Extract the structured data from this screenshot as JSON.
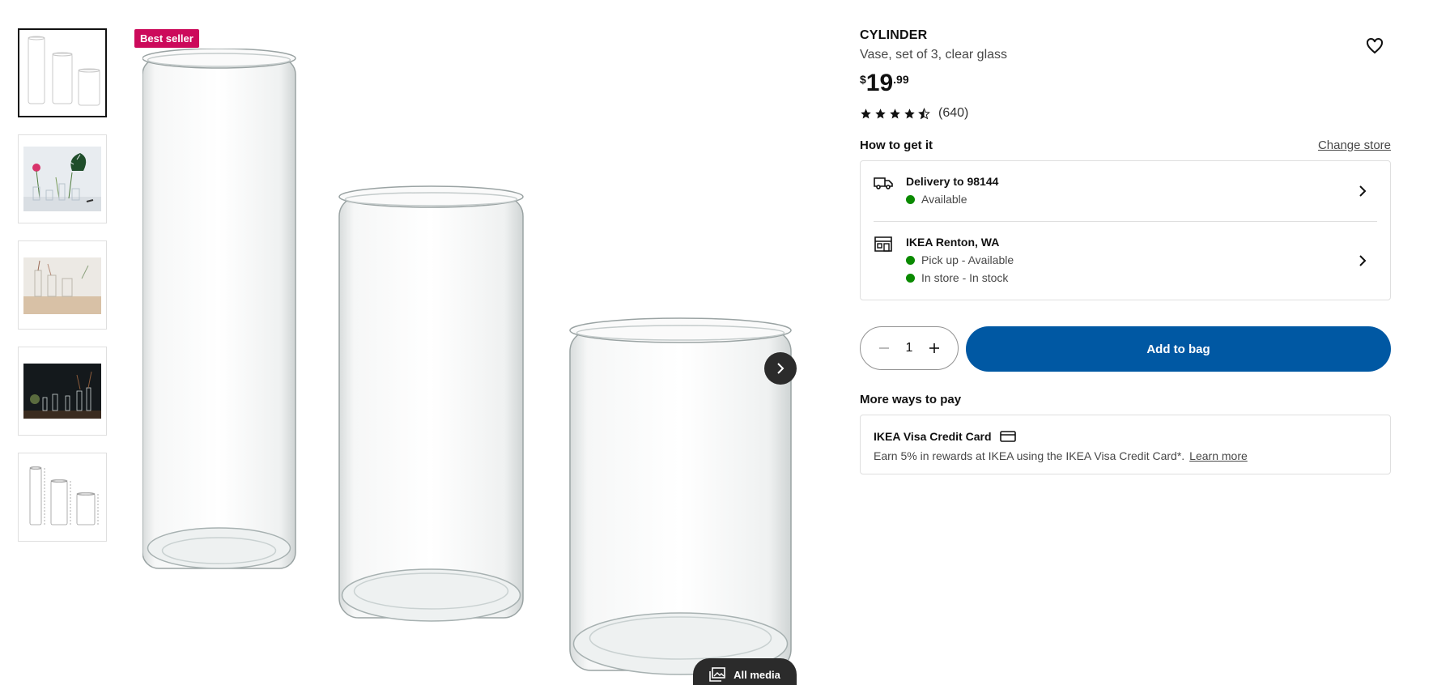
{
  "gallery": {
    "badge": "Best seller",
    "all_media_label": "All media",
    "thumbnails": [
      {
        "kind": "product-vases",
        "active": true
      },
      {
        "kind": "flowers-in-vases",
        "active": false
      },
      {
        "kind": "shelf-vases",
        "active": false
      },
      {
        "kind": "dark-background-vases",
        "active": false
      },
      {
        "kind": "dimensions-drawing",
        "active": false
      }
    ]
  },
  "product": {
    "name": "CYLINDER",
    "description": "Vase, set of 3, clear glass",
    "price_currency": "$",
    "price_int": "19",
    "price_dec": ".99",
    "rating_stars": 4.5,
    "rating_count": "(640)"
  },
  "how_to_get": {
    "title": "How to get it",
    "change_store": "Change store",
    "delivery": {
      "heading": "Delivery to 98144",
      "status": "Available"
    },
    "store": {
      "heading": "IKEA Renton, WA",
      "pickup": "Pick up - Available",
      "instore": "In store - In stock"
    }
  },
  "purchase": {
    "quantity": "1",
    "add_to_bag": "Add to bag"
  },
  "more_ways": {
    "title": "More ways to pay",
    "card_title": "IKEA Visa Credit Card",
    "card_text": "Earn 5% in rewards at IKEA using the IKEA Visa Credit Card*.",
    "learn_more": "Learn more"
  },
  "colors": {
    "badge": "#cc0a5b",
    "primary": "#0058a3",
    "available": "#0a8a00"
  }
}
